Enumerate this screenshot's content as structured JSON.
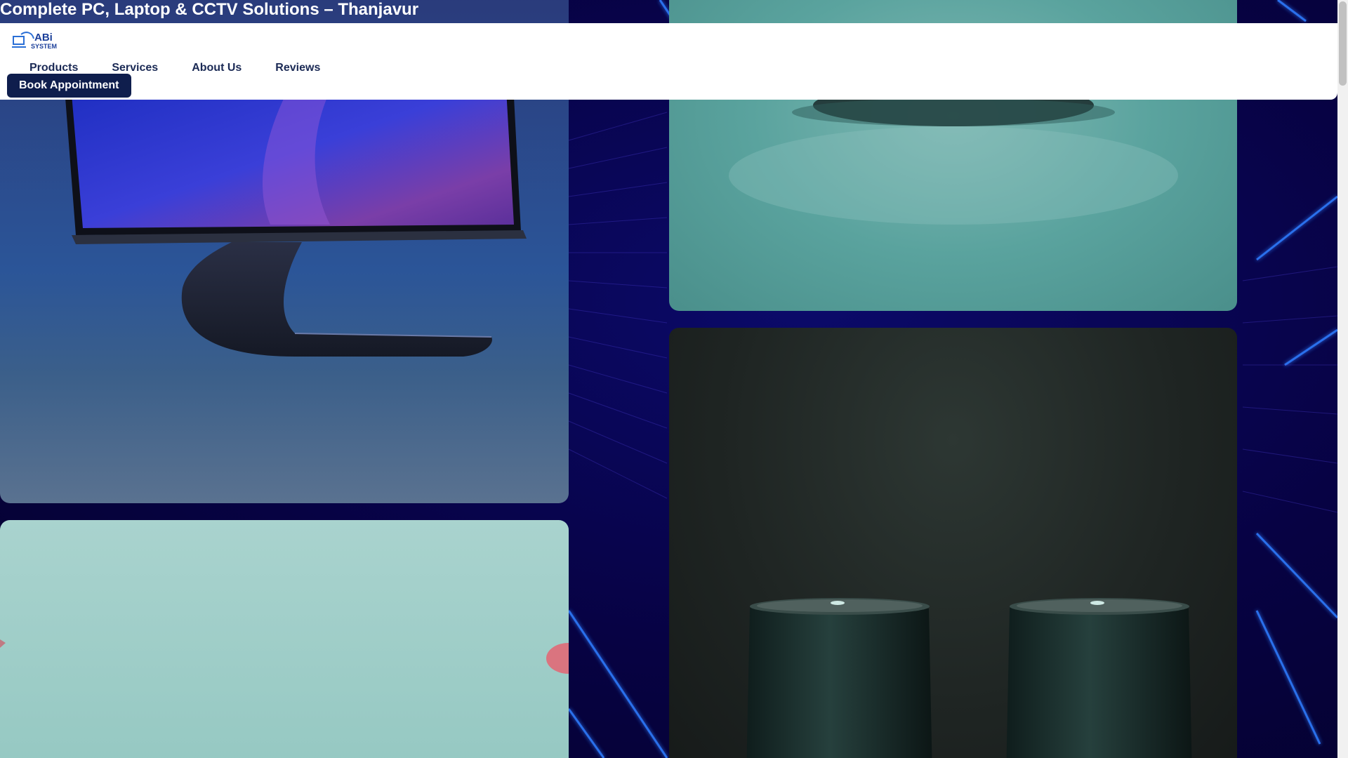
{
  "page": {
    "title": "Complete PC, Laptop & CCTV Solutions – Thanjavur"
  },
  "header": {
    "logo_alt": "ABI SYSTEM",
    "logo_line1": "ABi",
    "logo_line2": "SYSTEM",
    "nav": [
      {
        "label": "Products"
      },
      {
        "label": "Services"
      },
      {
        "label": "About Us"
      },
      {
        "label": "Reviews"
      }
    ],
    "cta_label": "Book Appointment"
  },
  "colors": {
    "background": "#070243",
    "header_bg": "#ffffff",
    "nav_text": "#1b2a55",
    "cta_bg": "#0f1e4d",
    "cta_text": "#ffffff",
    "accent_neon": "#2f7bff"
  },
  "gallery": {
    "images": [
      {
        "subject": "monitor"
      },
      {
        "subject": "teal-surface"
      },
      {
        "subject": "mint-surface"
      },
      {
        "subject": "smart-speakers"
      }
    ]
  }
}
